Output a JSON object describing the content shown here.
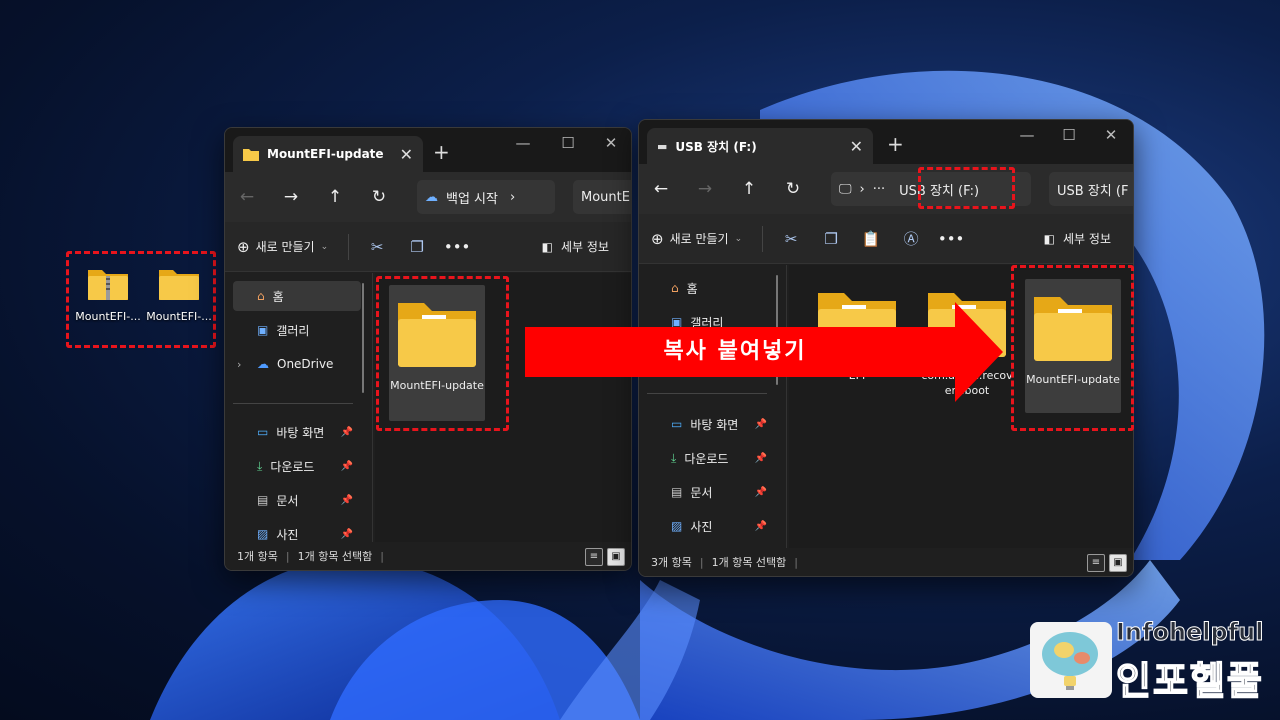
{
  "colors": {
    "highlight_red": "#e8141c",
    "folder_yellow": "#f7c948",
    "explorer_bg": "#1f1f1f"
  },
  "desktop": {
    "icons": [
      {
        "label": "MountEFI-...",
        "icon": "zip-folder-icon"
      },
      {
        "label": "MountEFI-...",
        "icon": "folder-icon"
      }
    ]
  },
  "left_window": {
    "tab_title": "MountEFI-update",
    "address": {
      "badge": "백업 시작",
      "crumb": "MountEFI-"
    },
    "toolbar": {
      "new": "새로 만들기",
      "details": "세부 정보"
    },
    "sidebar": [
      {
        "label": "홈",
        "icon": "home-icon"
      },
      {
        "label": "갤러리",
        "icon": "gallery-icon"
      },
      {
        "label": "OneDrive",
        "icon": "cloud-icon"
      },
      {
        "label": "바탕 화면",
        "icon": "desktop-icon"
      },
      {
        "label": "다운로드",
        "icon": "download-icon"
      },
      {
        "label": "문서",
        "icon": "document-icon"
      },
      {
        "label": "사진",
        "icon": "pictures-icon"
      }
    ],
    "files": [
      {
        "label": "MountEFI-update"
      }
    ],
    "status": {
      "count": "1개 항목",
      "selected": "1개 항목 선택함"
    }
  },
  "right_window": {
    "tab_title": "USB 장치 (F:)",
    "address": {
      "crumb": "USB 장치 (F:)",
      "search": "USB 장치 (F"
    },
    "toolbar": {
      "new": "새로 만들기",
      "details": "세부 정보"
    },
    "sidebar": [
      {
        "label": "홈",
        "icon": "home-icon"
      },
      {
        "label": "갤러리",
        "icon": "gallery-icon"
      },
      {
        "label": "바탕 화면",
        "icon": "desktop-icon"
      },
      {
        "label": "다운로드",
        "icon": "download-icon"
      },
      {
        "label": "문서",
        "icon": "document-icon"
      },
      {
        "label": "사진",
        "icon": "pictures-icon"
      }
    ],
    "files": [
      {
        "label": "EFI"
      },
      {
        "label": "com.apple.recovery.boot"
      },
      {
        "label": "MountEFI-update"
      }
    ],
    "status": {
      "count": "3개 항목",
      "selected": "1개 항목 선택함"
    }
  },
  "annotation": {
    "arrow_label": "복사 붙여넣기"
  },
  "watermark": {
    "en": "Infohelpful",
    "ko": "인포헬풀"
  }
}
